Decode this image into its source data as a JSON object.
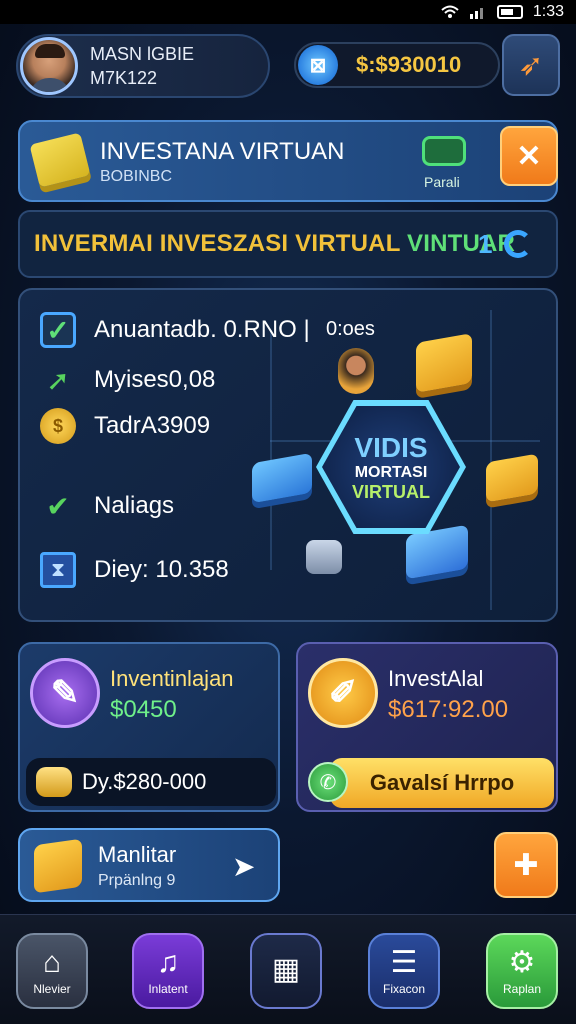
{
  "status_bar": {
    "time": "1:33"
  },
  "profile": {
    "name": "MASN lGBIE",
    "id": "M7K122"
  },
  "balance": {
    "value": "$:$930010"
  },
  "banner": {
    "title": "INVESTANA VIRTUAN",
    "subtitle": "BOBINBC",
    "action_label": "Parali"
  },
  "title_bar": {
    "text_main": "INVERMAI INVESZASI VIRTUAL ",
    "text_accent": "VINTUAR",
    "number": "1"
  },
  "stats": {
    "top_label": "0:oes",
    "items": [
      {
        "text": "Anuantadb. 0.RNO |"
      },
      {
        "text": "Myises0,08"
      },
      {
        "text": "TadrA3909"
      },
      {
        "text": "Naliags"
      },
      {
        "text": "Diey: 10.358"
      }
    ]
  },
  "hex_badge": {
    "line1": "VIDIS",
    "line2": "MORTASI",
    "line3": "VIRTUAL"
  },
  "card_left": {
    "title": "Inventinlajan",
    "value": "$0450",
    "bar_text": "Dy.$280-000"
  },
  "card_right": {
    "title": "InvestAlal",
    "value": "$617:92.00",
    "button_label": "Gavalsí Hrrpo"
  },
  "monitor": {
    "title": "Manlitar",
    "subtitle": "Prpänlng 9"
  },
  "nav": [
    {
      "label": "Nlevier"
    },
    {
      "label": "Inlatent"
    },
    {
      "label": ""
    },
    {
      "label": "Fixacon"
    },
    {
      "label": "Raplan"
    }
  ],
  "colors": {
    "accent_gold": "#f2c13a",
    "accent_green": "#5fe078",
    "accent_blue": "#4fb8ff",
    "orange": "#f07a1a"
  }
}
